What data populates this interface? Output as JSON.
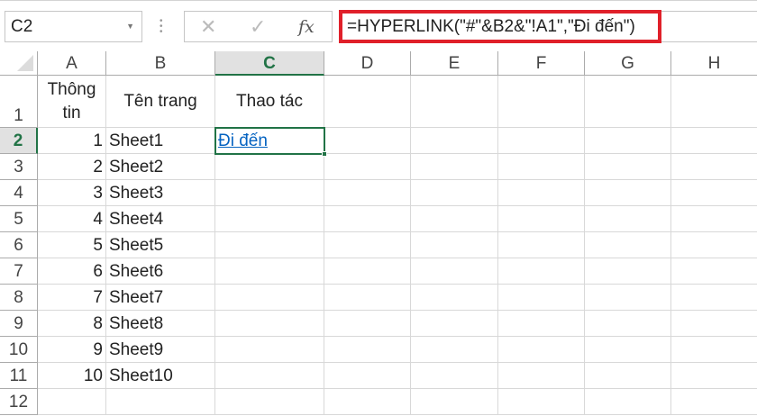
{
  "formula_bar": {
    "name_box": "C2",
    "cancel_icon": "✕",
    "enter_icon": "✓",
    "fx_label": "fx",
    "formula": "=HYPERLINK(\"#\"&B2&\"!A1\",\"Đi đến\")",
    "highlight_color": "#e0202a"
  },
  "columns": [
    "A",
    "B",
    "C",
    "D",
    "E",
    "F",
    "G",
    "H"
  ],
  "row_numbers": [
    "1",
    "2",
    "3",
    "4",
    "5",
    "6",
    "7",
    "8",
    "9",
    "10",
    "11",
    "12"
  ],
  "selected_cell": "C2",
  "header_row": {
    "A": "Thông tin",
    "B": "Tên trang",
    "C": "Thao tác"
  },
  "rows": [
    {
      "A": "1",
      "B": "Sheet1",
      "C": "Đi đến"
    },
    {
      "A": "2",
      "B": "Sheet2"
    },
    {
      "A": "3",
      "B": "Sheet3"
    },
    {
      "A": "4",
      "B": "Sheet4"
    },
    {
      "A": "5",
      "B": "Sheet5"
    },
    {
      "A": "6",
      "B": "Sheet6"
    },
    {
      "A": "7",
      "B": "Sheet7"
    },
    {
      "A": "8",
      "B": "Sheet8"
    },
    {
      "A": "9",
      "B": "Sheet9"
    },
    {
      "A": "10",
      "B": "Sheet10"
    }
  ]
}
